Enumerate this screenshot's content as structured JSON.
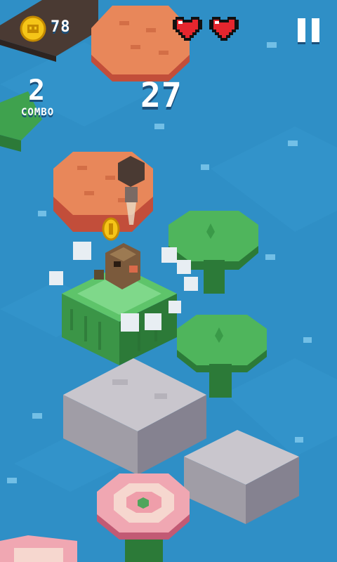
{
  "hud": {
    "coins": "78",
    "combo_value": "2",
    "combo_label": "COMBO",
    "score": "27",
    "lives": 2
  },
  "icons": {
    "coin": "coin-icon",
    "heart": "heart-icon",
    "pause": "pause-icon"
  },
  "colors": {
    "water": "#2f8fc6",
    "heart": "#e6262e",
    "coin": "#f5c518",
    "lily_pad": "#3fa24e",
    "stone": "#a7a4ad",
    "log_top": "#e8875a"
  }
}
